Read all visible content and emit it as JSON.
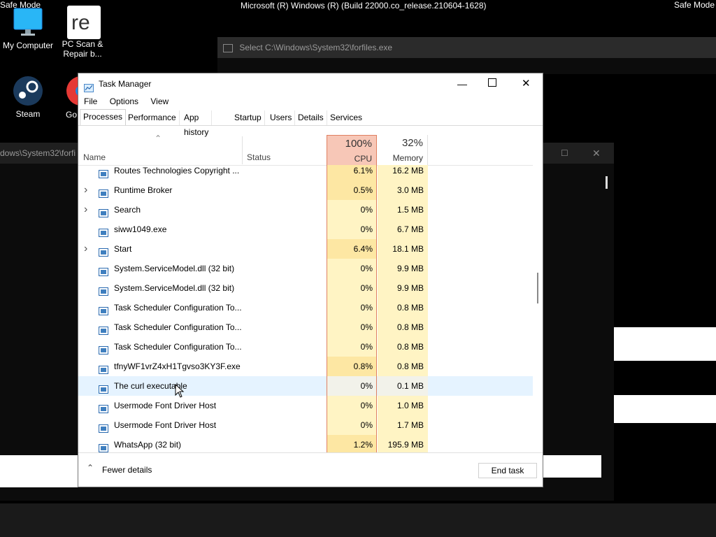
{
  "desktop": {
    "safe_mode_left": "Safe Mode",
    "safe_mode_right": "Safe Mode",
    "os_title": "Microsoft (R) Windows (R) (Build 22000.co_release.210604-1628)",
    "icons": {
      "my_computer": "My Computer",
      "pc_scan": "PC Scan & Repair b...",
      "steam": "Steam",
      "chrome_partial": "Go Chi"
    }
  },
  "console_windows": {
    "forfiles_title": "Select C:\\Windows\\System32\\forfiles.exe",
    "back_title_partial": "dows\\System32\\forfi"
  },
  "task_manager": {
    "title": "Task Manager",
    "menu": [
      "File",
      "Options",
      "View"
    ],
    "tabs": [
      "Processes",
      "Performance",
      "App history",
      "Startup",
      "Users",
      "Details",
      "Services"
    ],
    "columns": {
      "name": "Name",
      "status": "Status",
      "cpu_percent": "100%",
      "cpu": "CPU",
      "memory_percent": "32%",
      "memory": "Memory"
    },
    "rows": [
      {
        "name": "Routes Technologies Copyright ...",
        "cpu": "6.1%",
        "mem": "16.2 MB",
        "expand": ""
      },
      {
        "name": "Runtime Broker",
        "cpu": "0.5%",
        "mem": "3.0 MB",
        "expand": ">"
      },
      {
        "name": "Search",
        "cpu": "0%",
        "mem": "1.5 MB",
        "expand": ">"
      },
      {
        "name": "siww1049.exe",
        "cpu": "0%",
        "mem": "6.7 MB",
        "expand": ""
      },
      {
        "name": "Start",
        "cpu": "6.4%",
        "mem": "18.1 MB",
        "expand": ">"
      },
      {
        "name": "System.ServiceModel.dll (32 bit)",
        "cpu": "0%",
        "mem": "9.9 MB",
        "expand": ""
      },
      {
        "name": "System.ServiceModel.dll (32 bit)",
        "cpu": "0%",
        "mem": "9.9 MB",
        "expand": ""
      },
      {
        "name": "Task Scheduler Configuration To...",
        "cpu": "0%",
        "mem": "0.8 MB",
        "expand": ""
      },
      {
        "name": "Task Scheduler Configuration To...",
        "cpu": "0%",
        "mem": "0.8 MB",
        "expand": ""
      },
      {
        "name": "Task Scheduler Configuration To...",
        "cpu": "0%",
        "mem": "0.8 MB",
        "expand": ""
      },
      {
        "name": "tfnyWF1vrZ4xH1Tgvso3KY3F.exe",
        "cpu": "0.8%",
        "mem": "0.8 MB",
        "expand": ""
      },
      {
        "name": "The curl executable",
        "cpu": "0%",
        "mem": "0.1 MB",
        "expand": ""
      },
      {
        "name": "Usermode Font Driver Host",
        "cpu": "0%",
        "mem": "1.0 MB",
        "expand": ""
      },
      {
        "name": "Usermode Font Driver Host",
        "cpu": "0%",
        "mem": "1.7 MB",
        "expand": ""
      },
      {
        "name": "WhatsApp (32 bit)",
        "cpu": "1.2%",
        "mem": "195.9 MB",
        "expand": ""
      }
    ],
    "fewer_details": "Fewer details",
    "end_task": "End task"
  },
  "colors": {
    "cpu_header": "#f7c7b7",
    "cpu_cell": "#fff4c4",
    "cpu_cell_active": "#fde7a3",
    "mem_cell": "#fff4c4",
    "cpu_border": "#e08060",
    "highlight_row": "#e5f3ff"
  }
}
